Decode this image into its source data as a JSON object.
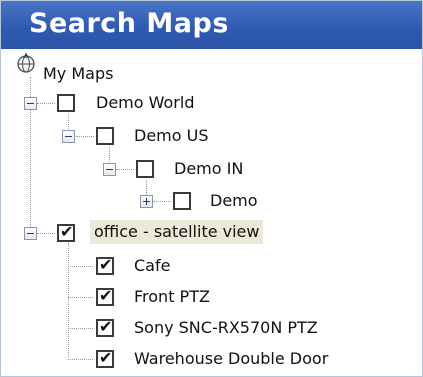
{
  "panel": {
    "title": "Search Maps"
  },
  "tree": {
    "root_label": "My Maps",
    "root_icon": "compass-globe-icon",
    "items": [
      {
        "label": "Demo World",
        "checked": false,
        "expanded": true
      },
      {
        "label": "Demo US",
        "checked": false,
        "expanded": true
      },
      {
        "label": "Demo IN",
        "checked": false,
        "expanded": true
      },
      {
        "label": "Demo",
        "checked": false,
        "expanded": false
      },
      {
        "label": "office - satellite view",
        "checked": true,
        "expanded": true,
        "selected": true
      },
      {
        "label": "Cafe",
        "checked": true
      },
      {
        "label": "Front PTZ",
        "checked": true
      },
      {
        "label": "Sony SNC-RX570N PTZ",
        "checked": true
      },
      {
        "label": "Warehouse Double Door",
        "checked": true
      }
    ]
  },
  "colors": {
    "header_bg": "#3160b8",
    "header_text": "#ffffff",
    "selection_bg": "#ece9d8"
  }
}
